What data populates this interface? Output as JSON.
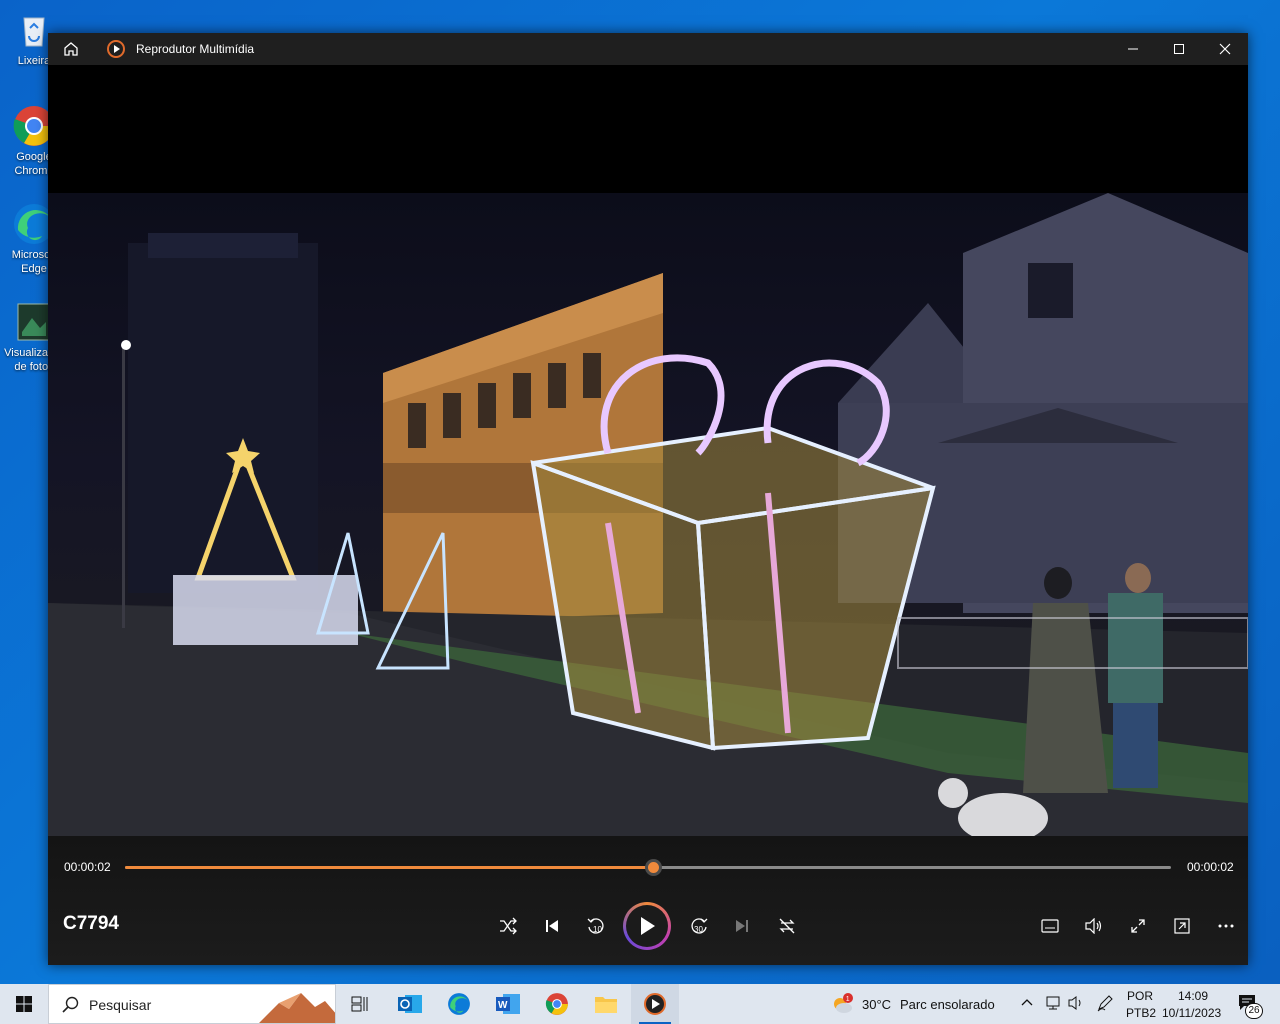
{
  "desktop": {
    "icons": [
      {
        "label": "Lixeira",
        "icon": "recycle-bin-icon"
      },
      {
        "label": "Google Chrome",
        "icon": "chrome-icon"
      },
      {
        "label": "Microsoft Edge",
        "icon": "edge-icon"
      },
      {
        "label": "Visualizador de fotos",
        "icon": "photo-viewer-icon"
      }
    ]
  },
  "window": {
    "title": "Reprodutor Multimídia",
    "home_icon": "home-icon",
    "buttons": {
      "minimize": "minimize-icon",
      "maximize": "maximize-icon",
      "close": "close-icon"
    }
  },
  "player": {
    "current_time": "00:00:02",
    "total_time": "00:00:02",
    "progress": 0.505,
    "media_title": "C7794",
    "accent": "#f08a3c",
    "controls": [
      "shuffle-icon",
      "previous-icon",
      "rewind-10-icon",
      "play-icon",
      "forward-30-icon",
      "next-icon",
      "repeat-icon",
      "captions-icon",
      "volume-icon",
      "fullscreen-icon",
      "miniplayer-icon",
      "more-icon"
    ],
    "rewind_label": "10",
    "forward_label": "30"
  },
  "taskbar": {
    "search_placeholder": "Pesquisar",
    "weather_temp": "30°C",
    "weather_desc": "Parc ensolarado",
    "language_top": "POR",
    "language_bottom": "PTB2",
    "time": "14:09",
    "date": "10/11/2023",
    "notification_count": "26",
    "weather_badge": "1"
  }
}
